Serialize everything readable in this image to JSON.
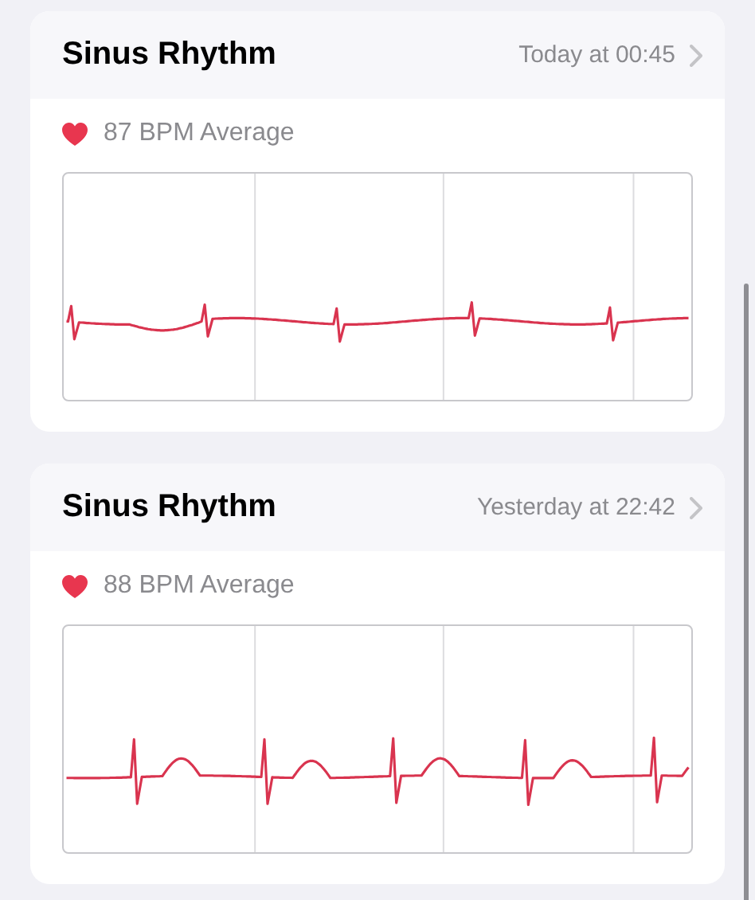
{
  "recordings": [
    {
      "title": "Sinus Rhythm",
      "time": "Today at 00:45",
      "average": "87 BPM Average"
    },
    {
      "title": "Sinus Rhythm",
      "time": "Yesterday at 22:42",
      "average": "88 BPM Average"
    }
  ]
}
